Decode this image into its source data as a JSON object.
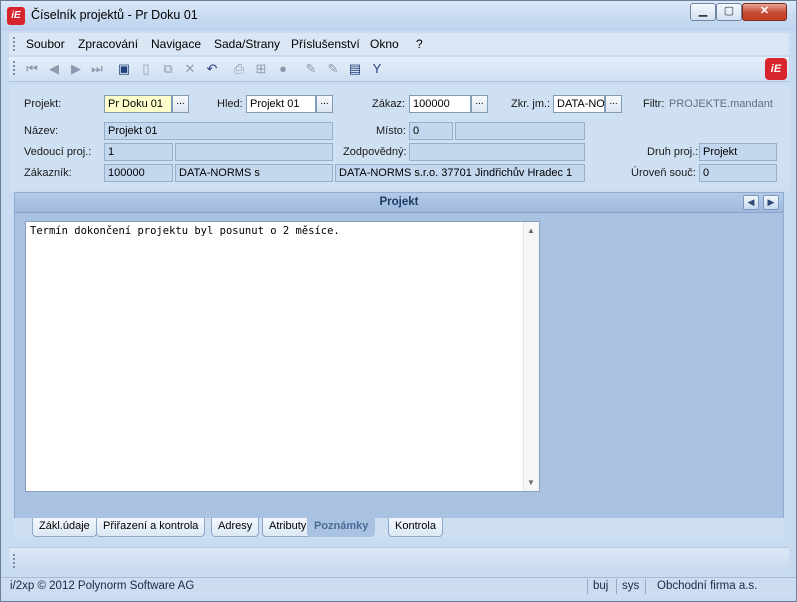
{
  "window": {
    "title": "Číselník projektů - Pr Doku 01",
    "minimize": "▁",
    "maximize": "▢",
    "close": "✕",
    "logo": "iE"
  },
  "menu": [
    "Soubor",
    "Zpracování",
    "Navigace",
    "Sada/Strany",
    "Příslušenství",
    "Okno",
    "?"
  ],
  "toolbar": {
    "icons": [
      "first-icon",
      "prev-icon",
      "next-icon",
      "last-icon",
      "save-icon",
      "new-icon",
      "copy-icon",
      "delete-icon",
      "undo-icon",
      "print-icon",
      "tree-icon",
      "stop-icon",
      "edit-icon",
      "edit2-icon",
      "sheet-icon",
      "filter-icon"
    ],
    "logo": "iE"
  },
  "form": {
    "projekt_label": "Projekt:",
    "projekt_value": "Pr Doku 01",
    "hled_label": "Hled:",
    "hled_value": "Projekt 01",
    "zakaz_label": "Zákaz:",
    "zakaz_value": "100000",
    "zkr_label": "Zkr. jm.:",
    "zkr_value": "DATA-NO",
    "filtr_label": "Filtr:",
    "filtr_value": "PROJEKTE.mandant",
    "dots": "...",
    "nazev_label": "Název:",
    "nazev_value": "Projekt 01",
    "misto_label": "Místo:",
    "misto_value": "0",
    "vedouci_label": "Vedoucí proj.:",
    "vedouci_value": "1",
    "zodpovedny_label": "Zodpovědný:",
    "druh_label": "Druh proj.:",
    "druh_value": "Projekt",
    "zakaznik_label": "Zákazník:",
    "zakaznik_id": "100000",
    "zakaznik_name": "DATA-NORMS s",
    "zakaznik_full": "DATA-NORMS s.r.o. 37701 Jindřichův Hradec 1",
    "uroven_label": "Úroveň souč:",
    "uroven_value": "0"
  },
  "panel": {
    "title": "Projekt",
    "notes": "Termín dokončení projektu byl posunut o 2 měsíce."
  },
  "tabs": [
    "Zákl.údaje",
    "Přiřazení a kontrola",
    "Adresy",
    "Atributy",
    "Poznámky",
    "Kontrola"
  ],
  "active_tab": "Poznámky",
  "status": {
    "copyright": "i/2xp © 2012 Polynorm Software AG",
    "user": "buj",
    "db": "sys",
    "company": "Obchodní firma a.s."
  }
}
